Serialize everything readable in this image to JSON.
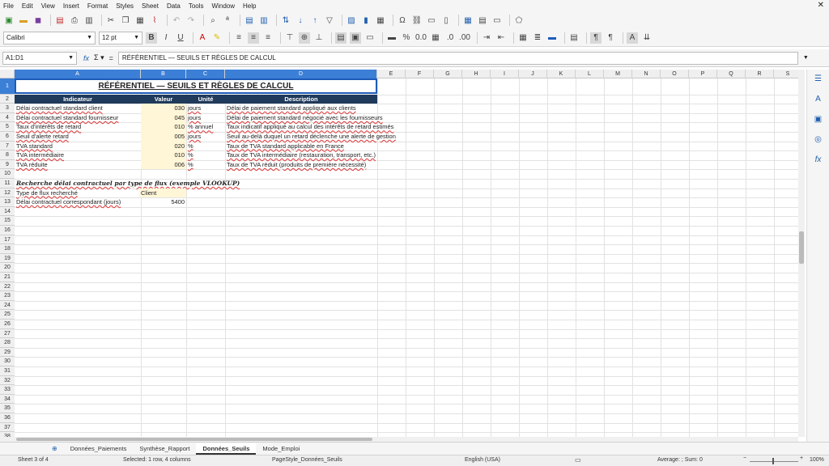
{
  "menu": [
    "File",
    "Edit",
    "View",
    "Insert",
    "Format",
    "Styles",
    "Sheet",
    "Data",
    "Tools",
    "Window",
    "Help"
  ],
  "toolbar": {
    "font_name": "Calibri",
    "font_size": "12 pt"
  },
  "formula_bar": {
    "name_box": "A1:D1",
    "content": "RÉFÉRENTIEL — SEUILS ET RÈGLES DE CALCUL"
  },
  "columns": [
    "A",
    "B",
    "C",
    "D",
    "E",
    "F",
    "G",
    "H",
    "I",
    "J",
    "K",
    "L",
    "M",
    "N",
    "O",
    "P",
    "Q",
    "R",
    "S"
  ],
  "rows": [
    "1",
    "2",
    "3",
    "4",
    "5",
    "6",
    "7",
    "8",
    "9",
    "10",
    "11",
    "12",
    "13",
    "14",
    "15",
    "16",
    "17",
    "18",
    "19",
    "20",
    "21",
    "22",
    "23",
    "24",
    "25",
    "26",
    "27",
    "28",
    "29",
    "30",
    "31",
    "32",
    "33",
    "34",
    "35",
    "36",
    "37",
    "38"
  ],
  "sheet": {
    "title": "RÉFÉRENTIEL — SEUILS ET RÈGLES DE CALCUL",
    "headers": [
      "Indicateur",
      "Valeur",
      "Unité",
      "Description"
    ],
    "data_rows": [
      {
        "a": "Délai contractuel standard client",
        "b": "030",
        "c": "jours",
        "d": "Délai de paiement standard appliqué aux clients"
      },
      {
        "a": "Délai contractuel standard fournisseur",
        "b": "045",
        "c": "jours",
        "d": "Délai de paiement standard négocié avec les fournisseurs"
      },
      {
        "a": "Taux d'intérêts de retard",
        "b": "010",
        "c": "% annuel",
        "d": "Taux indicatif appliqué au calcul des intérêts de retard estimés"
      },
      {
        "a": "Seuil d'alerte retard",
        "b": "005",
        "c": "jours",
        "d": "Seuil au-delà duquel un retard déclenche une alerte de gestion"
      },
      {
        "a": "TVA standard",
        "b": "020",
        "c": "%",
        "d": "Taux de TVA standard applicable en France"
      },
      {
        "a": "TVA intermédiaire",
        "b": "010",
        "c": "%",
        "d": "Taux de TVA intermédiaire (restauration, transport, etc.)"
      },
      {
        "a": "TVA réduite",
        "b": "006",
        "c": "%",
        "d": "Taux de TVA réduit (produits de première nécessité)"
      }
    ],
    "lookup_title": "Recherche délai contractuel par type de flux (exemple VLOOKUP)",
    "lookup_label": "Type de flux recherché",
    "lookup_value": "Client",
    "result_label": "Délai contractuel correspondant (jours)",
    "result_value": "5400"
  },
  "tabs": [
    "Données_Paiements",
    "Synthèse_Rapport",
    "Données_Seuils",
    "Mode_Emploi"
  ],
  "active_tab": "Données_Seuils",
  "status": {
    "sheet": "Sheet 3 of 4",
    "selection": "Selected: 1 row, 4 columns",
    "page_style": "PageStyle_Données_Seuils",
    "language": "English (USA)",
    "summary": "Average: ; Sum: 0",
    "zoom": "100%"
  },
  "colors": {
    "accent": "#3c7fd7",
    "header_fill": "#1f3a5a",
    "value_fill": "#fff6d8"
  }
}
